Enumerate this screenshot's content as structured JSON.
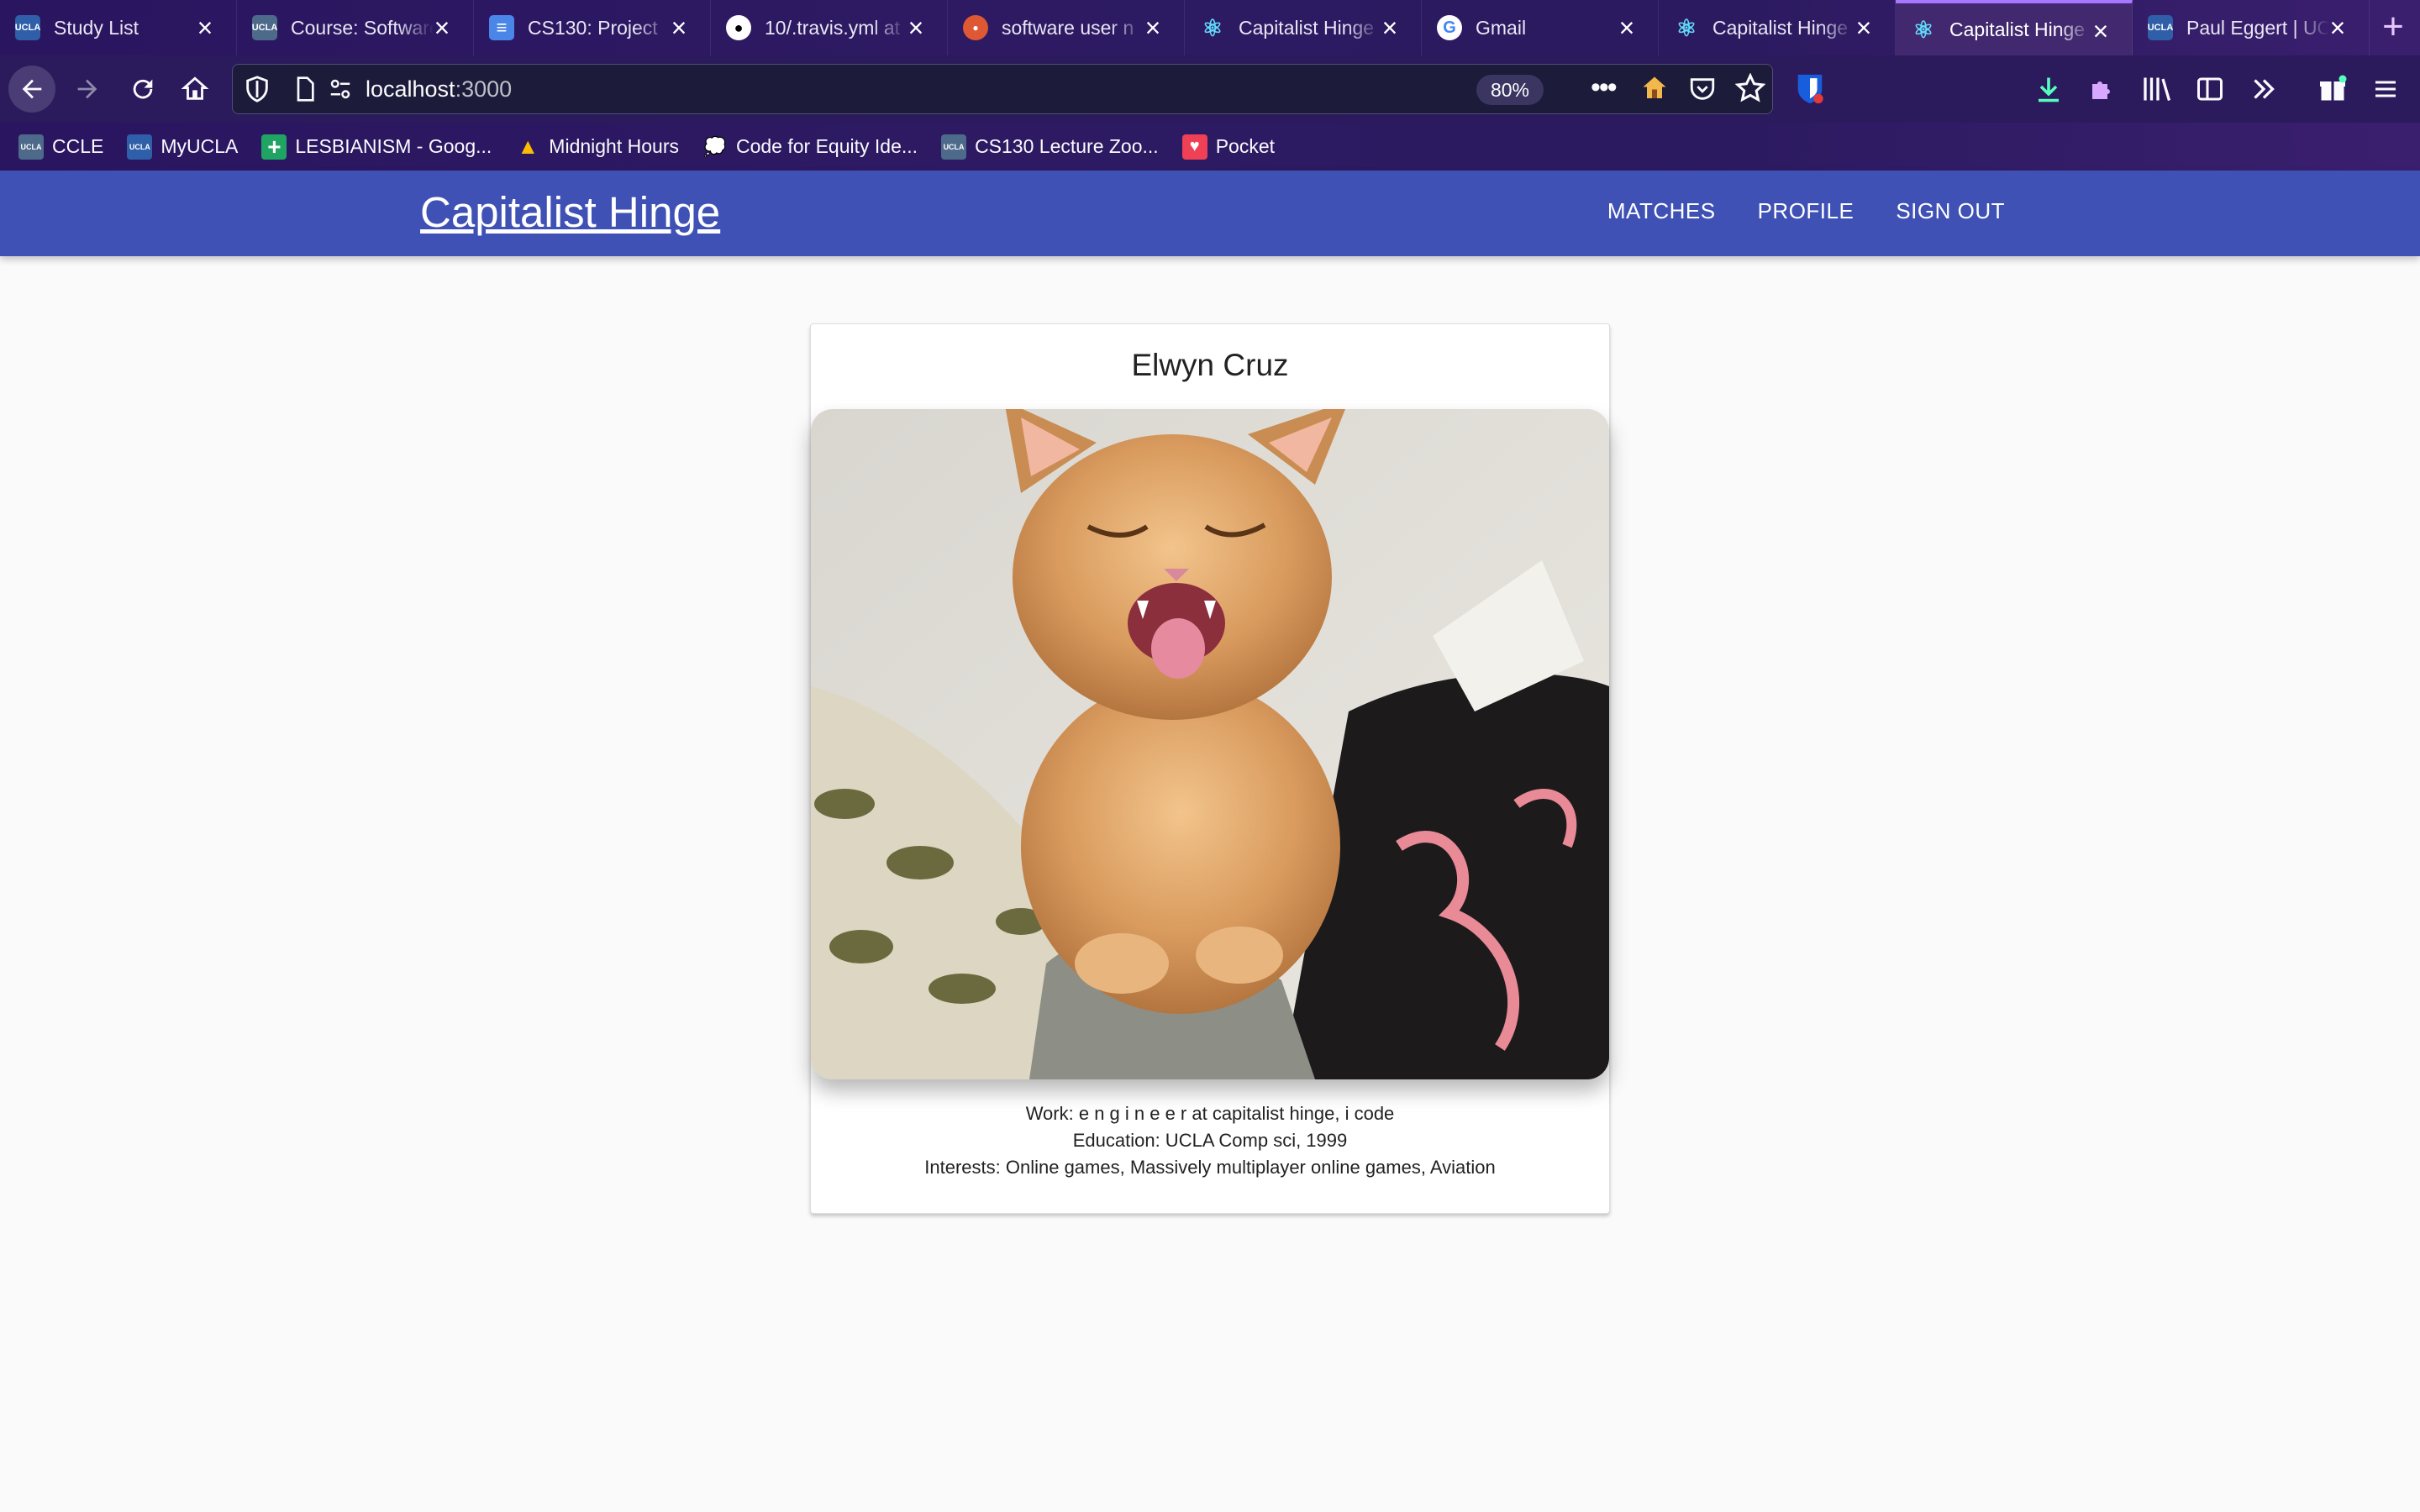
{
  "browser": {
    "tabs": [
      {
        "title": "Study List",
        "favicon": "ucla-icon",
        "color": "#2f5fa8",
        "active": false
      },
      {
        "title": "Course: Software",
        "favicon": "ucla-icon",
        "color": "#4d6a8a",
        "active": false
      },
      {
        "title": "CS130: Project",
        "favicon": "google-docs-icon",
        "color": "#4a86e8",
        "active": false
      },
      {
        "title": "10/.travis.yml at",
        "favicon": "github-icon",
        "color": "#ffffff",
        "active": false
      },
      {
        "title": "software user n",
        "favicon": "duckduckgo-icon",
        "color": "#de5833",
        "active": false
      },
      {
        "title": "Capitalist Hinge",
        "favicon": "react-icon",
        "color": "#61dafb",
        "active": false
      },
      {
        "title": "Gmail",
        "favicon": "google-icon",
        "color": "#ffffff",
        "active": false
      },
      {
        "title": "Capitalist Hinge",
        "favicon": "react-icon",
        "color": "#61dafb",
        "active": false
      },
      {
        "title": "Capitalist Hinge",
        "favicon": "react-icon",
        "color": "#61dafb",
        "active": true
      },
      {
        "title": "Paul Eggert | UC",
        "favicon": "ucla-icon",
        "color": "#2f5fa8",
        "active": false
      }
    ],
    "url_host": "localhost",
    "url_port": ":3000",
    "zoom": "80%",
    "bookmarks": [
      {
        "label": "CCLE",
        "icon": "ucla-icon",
        "color": "#4d6a8a"
      },
      {
        "label": "MyUCLA",
        "icon": "ucla-icon",
        "color": "#2f5fa8"
      },
      {
        "label": "LESBIANISM - Goog...",
        "icon": "google-sheets-icon",
        "color": "#1fa463"
      },
      {
        "label": "Midnight Hours",
        "icon": "google-drive-icon",
        "color": "#fbbc04"
      },
      {
        "label": "Code for Equity Ide...",
        "icon": "speech-bubble-icon",
        "color": "#ffffff"
      },
      {
        "label": "CS130 Lecture Zoo...",
        "icon": "ucla-icon",
        "color": "#4d6a8a"
      },
      {
        "label": "Pocket",
        "icon": "pocket-icon",
        "color": "#ef4056"
      }
    ]
  },
  "app": {
    "brand": "Capitalist Hinge",
    "nav": [
      "MATCHES",
      "PROFILE",
      "SIGN OUT"
    ],
    "profile": {
      "name": "Elwyn Cruz",
      "work": "Work: e n g i n e e r at capitalist hinge, i code",
      "education": "Education: UCLA Comp sci, 1999",
      "interests": "Interests: Online games, Massively multiplayer online games, Aviation"
    }
  },
  "colors": {
    "appbar": "#3f51b5",
    "chrome": "#2b1a5c",
    "active_tab_accent": "#a678ff"
  }
}
